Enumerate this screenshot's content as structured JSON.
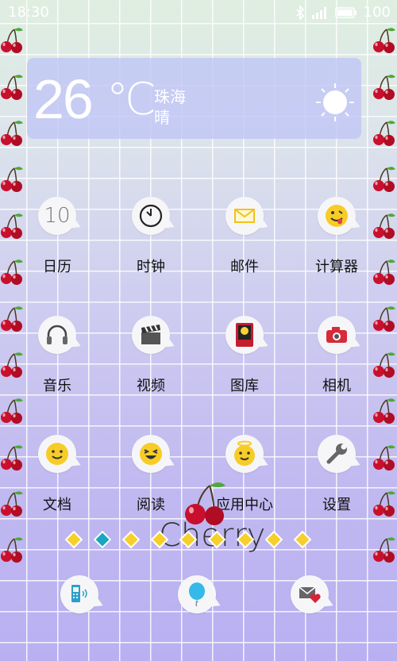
{
  "status": {
    "time": "18:30",
    "battery": "100"
  },
  "weather": {
    "temperature": "26",
    "unit": "℃",
    "city": "珠海",
    "condition": "晴"
  },
  "apps": [
    {
      "label": "日历",
      "icon": "calendar-icon",
      "icon_text": "10"
    },
    {
      "label": "时钟",
      "icon": "clock-icon"
    },
    {
      "label": "邮件",
      "icon": "mail-icon"
    },
    {
      "label": "计算器",
      "icon": "calculator-icon"
    },
    {
      "label": "音乐",
      "icon": "headphones-icon"
    },
    {
      "label": "视频",
      "icon": "clapperboard-icon"
    },
    {
      "label": "图库",
      "icon": "gallery-icon"
    },
    {
      "label": "相机",
      "icon": "camera-icon"
    },
    {
      "label": "文档",
      "icon": "smiley-icon"
    },
    {
      "label": "阅读",
      "icon": "laughing-icon"
    },
    {
      "label": "应用中心",
      "icon": "angel-smiley-icon"
    },
    {
      "label": "设置",
      "icon": "wrench-icon"
    }
  ],
  "page_indicator": {
    "count": 9,
    "active_index": 1
  },
  "theme_text": "Cherry",
  "dock": [
    {
      "icon": "phone-icon"
    },
    {
      "icon": "balloon-icon"
    },
    {
      "icon": "message-icon"
    }
  ],
  "colors": {
    "accent_yellow": "#f7cf2a",
    "active_dot": "#17a7c0",
    "cherry_red": "#c8102e"
  }
}
